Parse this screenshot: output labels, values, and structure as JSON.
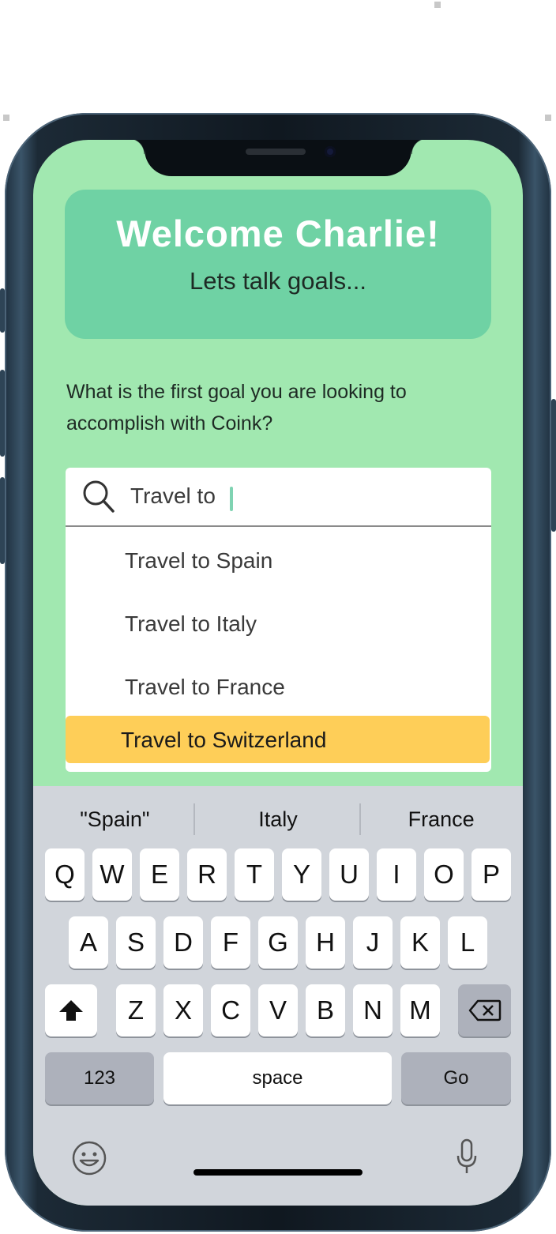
{
  "welcome": {
    "title": "Welcome Charlie!",
    "subtitle": "Lets talk goals..."
  },
  "question": "What is the first goal you are looking to accomplish with Coink?",
  "search": {
    "value": "Travel to",
    "icon": "search-icon"
  },
  "suggestions": [
    {
      "label": "Travel to Spain"
    },
    {
      "label": "Travel to Italy"
    },
    {
      "label": "Travel to France"
    },
    {
      "label": "Travel to Switzerland",
      "highlighted": true
    }
  ],
  "keyboard": {
    "predictions": [
      "\"Spain\"",
      "Italy",
      "France"
    ],
    "row1": [
      "Q",
      "W",
      "E",
      "R",
      "T",
      "Y",
      "U",
      "I",
      "O",
      "P"
    ],
    "row2": [
      "A",
      "S",
      "D",
      "F",
      "G",
      "H",
      "J",
      "K",
      "L"
    ],
    "row3": [
      "Z",
      "X",
      "C",
      "V",
      "B",
      "N",
      "M"
    ],
    "numbers_label": "123",
    "space_label": "space",
    "go_label": "Go"
  },
  "colors": {
    "screen_bg": "#a1e8b0",
    "card_bg": "#6fd2a4",
    "highlight": "#fece58",
    "keyboard_bg": "#d1d5db"
  }
}
